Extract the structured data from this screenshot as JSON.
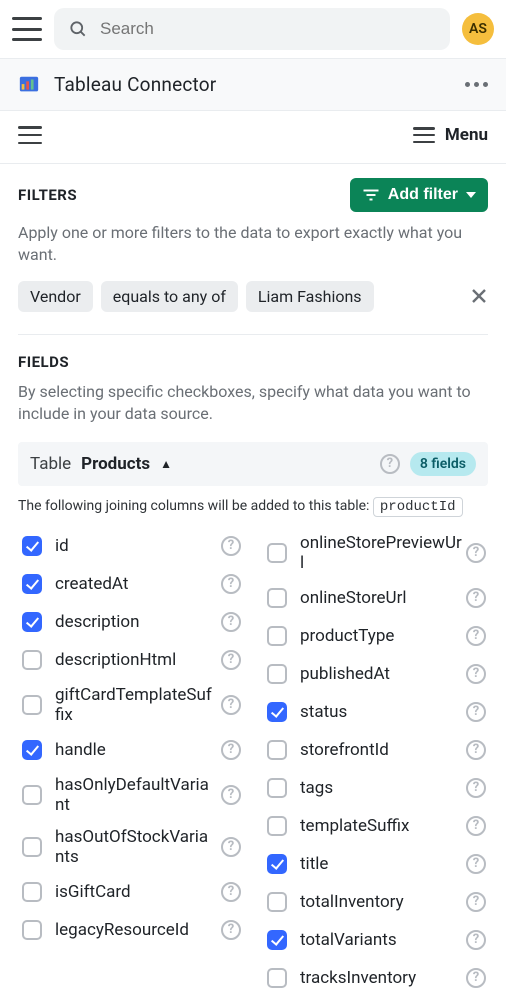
{
  "header": {
    "search_placeholder": "Search",
    "avatar_initials": "AS",
    "app_title": "Tableau Connector",
    "menu_label": "Menu"
  },
  "filters": {
    "heading": "FILTERS",
    "add_filter_label": "Add filter",
    "description": "Apply one or more filters to the data to export exactly what you want.",
    "chips": [
      "Vendor",
      "equals to any of",
      "Liam Fashions"
    ]
  },
  "fields": {
    "heading": "FIELDS",
    "description": "By selecting specific checkboxes, specify what data you want to include in your data source.",
    "table_label": "Table",
    "table_name": "Products",
    "badge": "8 fields",
    "join_note_prefix": "The following joining columns will be added to this table: ",
    "join_column": "productId",
    "left": [
      {
        "name": "id",
        "checked": true
      },
      {
        "name": "createdAt",
        "checked": true
      },
      {
        "name": "description",
        "checked": true
      },
      {
        "name": "descriptionHtml",
        "checked": false
      },
      {
        "name": "giftCardTemplateSuffix",
        "checked": false
      },
      {
        "name": "handle",
        "checked": true
      },
      {
        "name": "hasOnlyDefaultVariant",
        "checked": false
      },
      {
        "name": "hasOutOfStockVariants",
        "checked": false
      },
      {
        "name": "isGiftCard",
        "checked": false
      },
      {
        "name": "legacyResourceId",
        "checked": false
      }
    ],
    "right": [
      {
        "name": "onlineStorePreviewUrl",
        "checked": false
      },
      {
        "name": "onlineStoreUrl",
        "checked": false
      },
      {
        "name": "productType",
        "checked": false
      },
      {
        "name": "publishedAt",
        "checked": false
      },
      {
        "name": "status",
        "checked": true
      },
      {
        "name": "storefrontId",
        "checked": false
      },
      {
        "name": "tags",
        "checked": false
      },
      {
        "name": "templateSuffix",
        "checked": false
      },
      {
        "name": "title",
        "checked": true
      },
      {
        "name": "totalInventory",
        "checked": false
      },
      {
        "name": "totalVariants",
        "checked": true
      },
      {
        "name": "tracksInventory",
        "checked": false
      }
    ]
  }
}
